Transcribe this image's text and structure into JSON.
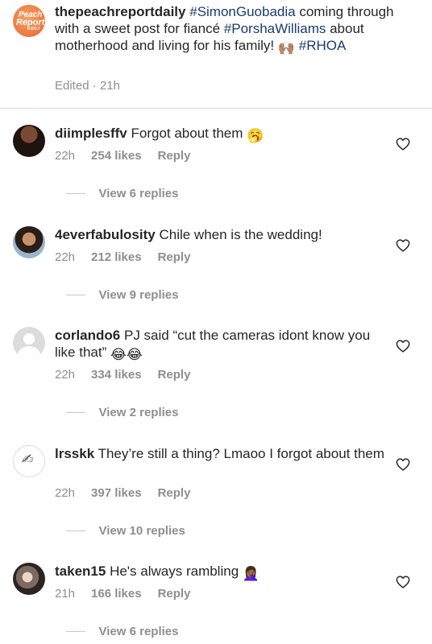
{
  "post": {
    "username": "thepeachreportdaily",
    "avatar_text": {
      "line1": "Peach",
      "line2": "Report",
      "line3": "DAILY"
    },
    "caption_parts": [
      {
        "type": "tag",
        "text": "#SimonGuobadia"
      },
      {
        "type": "text",
        "text": " coming through with a sweet post for fiancé "
      },
      {
        "type": "tag",
        "text": "#PorshaWilliams"
      },
      {
        "type": "text",
        "text": " about motherhood and living for his family! "
      },
      {
        "type": "emoji",
        "text": "🙌🏽"
      },
      {
        "type": "text",
        "text": " "
      },
      {
        "type": "tag",
        "text": "#RHOA"
      }
    ],
    "edited_label": "Edited · 21h"
  },
  "comments": [
    {
      "username": "diimplesffv",
      "text": "Forgot about them",
      "emoji": "🥱",
      "time": "22h",
      "likes": "254 likes",
      "reply": "Reply",
      "view_replies": "View 6 replies",
      "avatar": "profile-photo"
    },
    {
      "username": "4everfabulosity",
      "text": "Chile when is the wedding!",
      "emoji": "",
      "time": "22h",
      "likes": "212 likes",
      "reply": "Reply",
      "view_replies": "View 9 replies",
      "avatar": "profile-photo"
    },
    {
      "username": "corlando6",
      "text": "PJ said “cut the cameras idont know you like that”",
      "emoji": "😂😂",
      "time": "22h",
      "likes": "334 likes",
      "reply": "Reply",
      "view_replies": "View 2 replies",
      "avatar": "default-avatar"
    },
    {
      "username": "lrsskk",
      "text": "They’re still a thing? Lmaoo I forgot about them",
      "emoji": "",
      "time": "22h",
      "likes": "397 likes",
      "reply": "Reply",
      "view_replies": "View 10 replies",
      "avatar": "signature-avatar"
    },
    {
      "username": "taken15",
      "text": "He's always rambling",
      "emoji": "🤦🏾‍♀️",
      "time": "21h",
      "likes": "166 likes",
      "reply": "Reply",
      "view_replies": "View 6 replies",
      "avatar": "profile-photo"
    }
  ],
  "icons": {
    "like": "heart-outline-icon"
  },
  "colors": {
    "hashtag": "#1c3b6e",
    "secondary_text": "#8e8e8e",
    "divider": "#dbdbdb",
    "avatar_orange": "#ee7d44"
  }
}
